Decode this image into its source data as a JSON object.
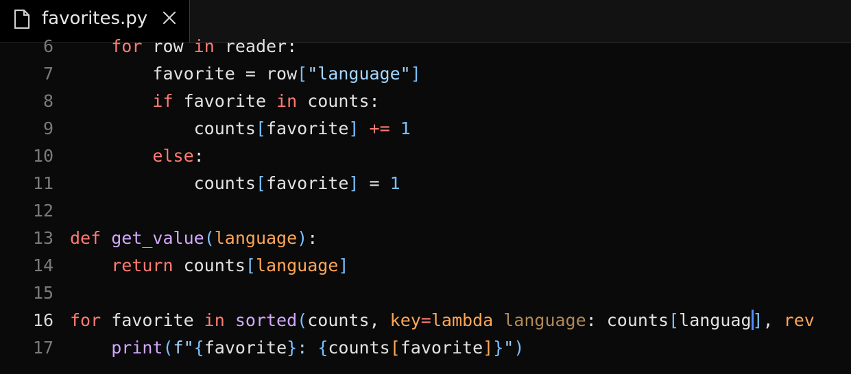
{
  "tab": {
    "filename": "favorites.py",
    "file_icon": "file-icon",
    "close_icon": "close-icon"
  },
  "colors": {
    "background": "#0a0a0a",
    "keyword": "#ff7b72",
    "function": "#d2a8ff",
    "bracket": "#79c0ff",
    "string": "#a5d6ff",
    "parameter": "#ffa657",
    "cursor": "#4f8cff"
  },
  "lines": [
    {
      "num": "6",
      "tokens": [
        {
          "t": "    "
        },
        {
          "t": "for",
          "c": "kw"
        },
        {
          "t": " row "
        },
        {
          "t": "in",
          "c": "kw"
        },
        {
          "t": " reader:"
        }
      ]
    },
    {
      "num": "7",
      "tokens": [
        {
          "t": "        favorite = row"
        },
        {
          "t": "[",
          "c": "br"
        },
        {
          "t": "\"language\"",
          "c": "str"
        },
        {
          "t": "]",
          "c": "br"
        }
      ]
    },
    {
      "num": "8",
      "tokens": [
        {
          "t": "        "
        },
        {
          "t": "if",
          "c": "kw"
        },
        {
          "t": " favorite "
        },
        {
          "t": "in",
          "c": "kw"
        },
        {
          "t": " counts:"
        }
      ]
    },
    {
      "num": "9",
      "tokens": [
        {
          "t": "            counts"
        },
        {
          "t": "[",
          "c": "br"
        },
        {
          "t": "favorite"
        },
        {
          "t": "]",
          "c": "br"
        },
        {
          "t": " "
        },
        {
          "t": "+=",
          "c": "op"
        },
        {
          "t": " "
        },
        {
          "t": "1",
          "c": "num"
        }
      ]
    },
    {
      "num": "10",
      "tokens": [
        {
          "t": "        "
        },
        {
          "t": "else",
          "c": "kw"
        },
        {
          "t": ":"
        }
      ]
    },
    {
      "num": "11",
      "tokens": [
        {
          "t": "            counts"
        },
        {
          "t": "[",
          "c": "br"
        },
        {
          "t": "favorite"
        },
        {
          "t": "]",
          "c": "br"
        },
        {
          "t": " = "
        },
        {
          "t": "1",
          "c": "num"
        }
      ]
    },
    {
      "num": "12",
      "tokens": []
    },
    {
      "num": "13",
      "tokens": [
        {
          "t": "def",
          "c": "kw"
        },
        {
          "t": " "
        },
        {
          "t": "get_value",
          "c": "fn"
        },
        {
          "t": "(",
          "c": "br"
        },
        {
          "t": "language",
          "c": "par"
        },
        {
          "t": ")",
          "c": "br"
        },
        {
          "t": ":"
        }
      ]
    },
    {
      "num": "14",
      "tokens": [
        {
          "t": "    "
        },
        {
          "t": "return",
          "c": "kw"
        },
        {
          "t": " counts"
        },
        {
          "t": "[",
          "c": "br"
        },
        {
          "t": "language",
          "c": "par"
        },
        {
          "t": "]",
          "c": "br"
        }
      ]
    },
    {
      "num": "15",
      "tokens": []
    },
    {
      "num": "16",
      "active": true,
      "tokens": [
        {
          "t": "for",
          "c": "kw"
        },
        {
          "t": " favorite "
        },
        {
          "t": "in",
          "c": "kw"
        },
        {
          "t": " "
        },
        {
          "t": "sorted",
          "c": "fn"
        },
        {
          "t": "(",
          "c": "br"
        },
        {
          "t": "counts, "
        },
        {
          "t": "key",
          "c": "kwarg"
        },
        {
          "t": "=",
          "c": "op"
        },
        {
          "t": "lambda",
          "c": "lam"
        },
        {
          "t": " "
        },
        {
          "t": "language",
          "c": "lamparam"
        },
        {
          "t": ": counts"
        },
        {
          "t": "[",
          "c": "br"
        },
        {
          "t": "languag"
        },
        {
          "t": "|CURSOR|",
          "c": "cursor"
        },
        {
          "t": "]",
          "c": "br"
        },
        {
          "t": ", "
        },
        {
          "t": "rev",
          "c": "kwarg"
        }
      ]
    },
    {
      "num": "17",
      "tokens": [
        {
          "t": "    "
        },
        {
          "t": "print",
          "c": "fn"
        },
        {
          "t": "(",
          "c": "br"
        },
        {
          "t": "f\"",
          "c": "str"
        },
        {
          "t": "{",
          "c": "br"
        },
        {
          "t": "favorite"
        },
        {
          "t": "}",
          "c": "br"
        },
        {
          "t": ": ",
          "c": "str"
        },
        {
          "t": "{",
          "c": "br"
        },
        {
          "t": "counts"
        },
        {
          "t": "[",
          "c": "par"
        },
        {
          "t": "favorite"
        },
        {
          "t": "]",
          "c": "par"
        },
        {
          "t": "}",
          "c": "br"
        },
        {
          "t": "\"",
          "c": "str"
        },
        {
          "t": ")",
          "c": "br"
        }
      ]
    }
  ]
}
